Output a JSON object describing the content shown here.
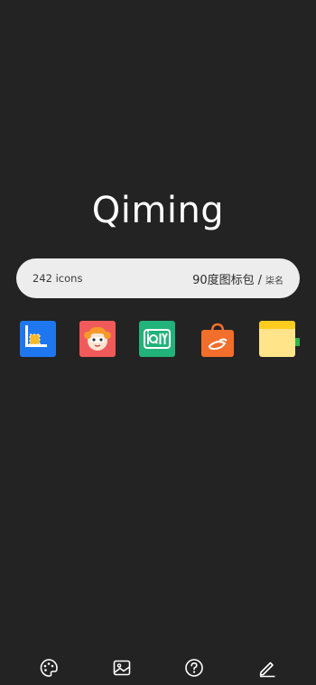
{
  "header": {
    "logo": "Qiming"
  },
  "info": {
    "icon_count": "242 icons",
    "pack_name": "90度图标包",
    "separator": "/",
    "author": "柒名"
  },
  "icons": [
    {
      "name": "blue-square-app-icon"
    },
    {
      "name": "anime-girl-app-icon"
    },
    {
      "name": "iqiyi-app-icon"
    },
    {
      "name": "alibaba-shopping-bag-icon"
    },
    {
      "name": "yellow-notes-app-icon"
    }
  ],
  "bottom_bar": {
    "items": [
      {
        "icon": "palette-icon"
      },
      {
        "icon": "image-icon"
      },
      {
        "icon": "help-icon"
      },
      {
        "icon": "edit-icon"
      }
    ]
  },
  "colors": {
    "background": "#232323",
    "pill": "#ededed",
    "iqiyi": "#22b37a",
    "alibaba": "#f26e2b",
    "note_yellow": "#ffe48a"
  }
}
